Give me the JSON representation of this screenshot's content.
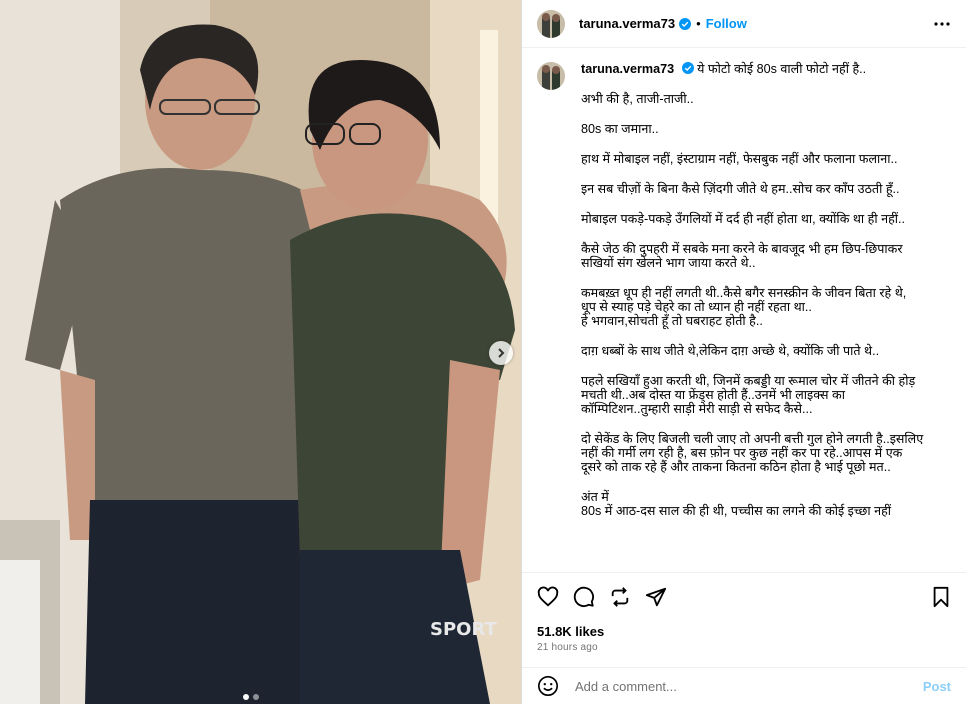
{
  "post": {
    "username": "taruna.verma73",
    "separator": "•",
    "follow_label": "Follow",
    "caption_first": "ये फोटो कोई 80s वाली फोटो नहीं है..",
    "caption_paragraphs": [
      "अभी की है, ताजी-ताजी..",
      "80s का जमाना..",
      "हाथ में मोबाइल नहीं, इंस्टाग्राम नहीं, फेसबुक नहीं और फलाना फलाना..",
      "इन सब चीज़ों के बिना कैसे ज़िंदगी जीते थे हम..सोच कर काँप उठती हूँ..",
      "मोबाइल पकड़े-पकड़े उँगलियों में दर्द ही नहीं होता था, क्योंकि था ही नहीं..",
      "कैसे जेठ की दुपहरी में सबके मना करने के बावजूद भी हम छिप-छिपाकर\nसखियों संग खेलने भाग जाया करते थे..",
      "कमबख़्त धूप ही नहीं लगती थी..कैसे बगैर सनस्क्रीन के जीवन बिता रहे थे,\nधूप से स्याह पड़े चेहरे का तो ध्यान ही नहीं रहता था..\nहे भगवान,सोचती हूँ तो घबराहट होती है..",
      "दाग़ धब्बों के साथ जीते थे,लेकिन दाग़ अच्छे थे, क्योंकि जी पाते थे..",
      "पहले सखियाँ हुआ करती थी, जिनमें कबड्डी या रूमाल चोर में जीतने की होड़\nमचती थी..अब दोस्त या फ्रेंड्स होती हैं..उनमें भी लाइक्स का\nकॉम्पिटिशन..तुम्हारी साड़ी मेरी साड़ी से सफेद कैसे...",
      "दो सेकेंड के लिए बिजली चली जाए तो अपनी बत्ती गुल होने लगती है..इसलिए\nनहीं की गर्मी लग रही है, बस फ़ोन पर कुछ नहीं कर पा रहे..आपस में एक\nदूसरे को ताक रहे हैं और ताकना कितना कठिन होता है भाई पूछो मत..",
      "अंत में\n80s में आठ-दस साल की ही थी, पच्चीस का लगने की कोई इच्छा नहीं"
    ],
    "likes": "51.8K likes",
    "time": "21 hours ago",
    "comment_placeholder": "Add a comment...",
    "post_label": "Post"
  },
  "icons": {
    "more": "more-options-icon",
    "like": "heart-icon",
    "comment": "comment-icon",
    "share_repost": "repost-icon",
    "send": "send-icon",
    "save": "bookmark-icon",
    "emoji": "emoji-icon",
    "carousel_next": "chevron-right-icon",
    "verified": "verified-badge-icon"
  },
  "colors": {
    "accent": "#0095f6",
    "muted": "#737373",
    "border": "#dbdbdb"
  },
  "carousel": {
    "count": 2,
    "active": 1
  }
}
